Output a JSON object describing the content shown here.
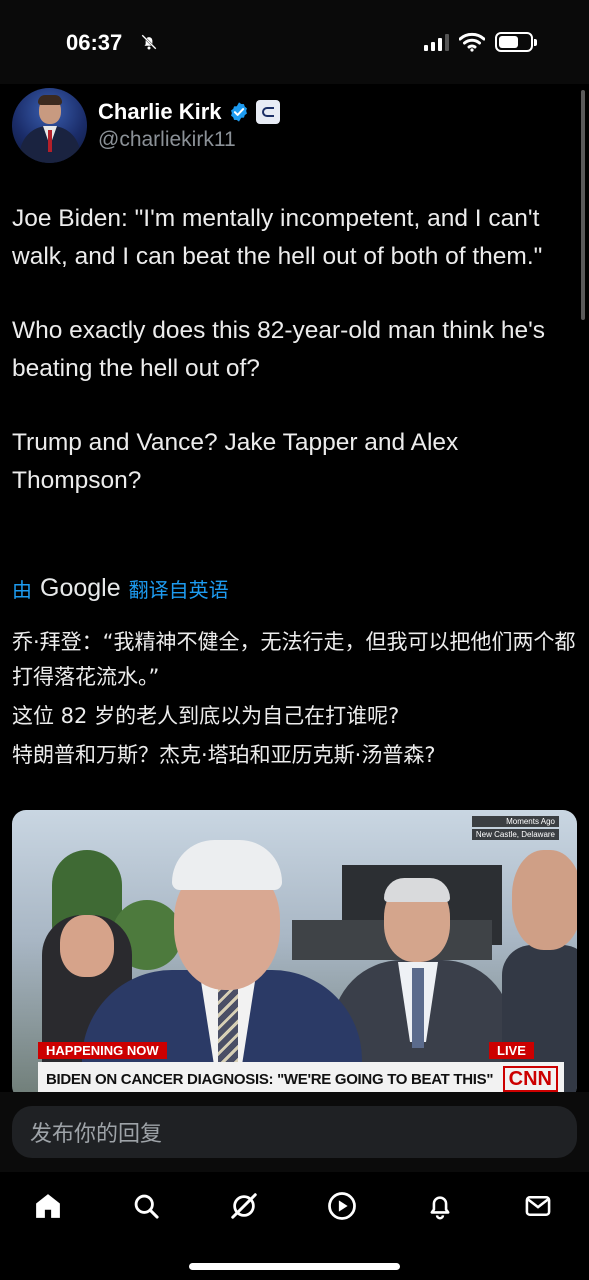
{
  "status_bar": {
    "time": "06:37",
    "icons": [
      "bell-off-icon",
      "signal-icon",
      "wifi-icon",
      "battery-icon"
    ]
  },
  "author": {
    "name": "Charlie Kirk",
    "handle": "@charliekirk11",
    "verified": true,
    "verified_color": "#1d9bf0"
  },
  "tweet": {
    "paragraphs": [
      "Joe Biden: \"I'm mentally incompetent, and I can't walk, and I can beat the hell out of both of them.\"",
      "Who exactly does this 82-year-old man think he's beating the hell out of?",
      "Trump and Vance? Jake Tapper and Alex Thompson?"
    ]
  },
  "translation": {
    "prefix": "由",
    "provider": "Google",
    "suffix": "翻译自英语",
    "lines": [
      "乔·拜登：“我精神不健全，无法行走，但我可以把他们两个都打得落花流水。”",
      "这位 82 岁的老人到底以为自己在打谁呢?",
      "特朗普和万斯？杰克·塔珀和亚历克斯·汤普森?"
    ]
  },
  "video": {
    "overlay_top_1": "Moments Ago",
    "overlay_top_2": "New Castle, Delaware",
    "happening_now": "HAPPENING NOW",
    "live": "LIVE",
    "chyron": "BIDEN ON CANCER DIAGNOSIS: \"WE'RE GOING TO BEAT THIS\"",
    "logo": "CNN",
    "accent_color": "#cc0000"
  },
  "reply": {
    "placeholder": "发布你的回复"
  },
  "tab_bar": {
    "items": [
      "home-icon",
      "search-icon",
      "grok-icon",
      "video-icon",
      "notifications-icon",
      "messages-icon"
    ],
    "active": "home-icon"
  },
  "colors": {
    "background": "#000000",
    "link_blue": "#1d9bf0",
    "text": "#e7e9ea",
    "muted": "#8b9197"
  }
}
